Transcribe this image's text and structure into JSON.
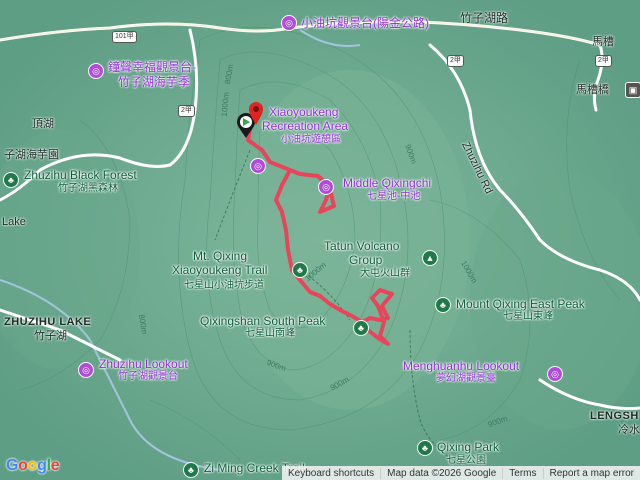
{
  "map": {
    "poi_labels": {
      "xiaoyoukeng_viewpoint_zh": "小油坑觀景台(陽金公路)",
      "bell_viewpoint_zh": "鐘聲幸福觀景台-",
      "bell_viewpoint_zh2": "竹子湖海芋季",
      "xiaoyoukeng_rec_en1": "Xiaoyoukeng",
      "xiaoyoukeng_rec_en2": "Recreation Area",
      "xiaoyoukeng_rec_zh": "小油坑遊憩區",
      "middle_qixingchi_en": "Middle Qixingchi",
      "middle_qixingchi_zh": "七星池-中池",
      "zhuzihu_lookout_en": "Zhuzihu Lookout",
      "zhuzihu_lookout_zh": "竹子湖觀景台",
      "menghuanhu_lookout_en": "Menghuanhu Lookout",
      "menghuanhu_lookout_zh": "夢幻湖觀景臺"
    },
    "park_labels": {
      "black_forest_en": "Zhuzihu Black Forest",
      "black_forest_zh": "竹子湖黑森林",
      "trail_en1": "Mt. Qixing",
      "trail_en2": "Xiaoyoukeng Trail",
      "trail_zh": "七星山小油坑步道",
      "south_peak_en": "Qixingshan South Peak",
      "south_peak_zh": "七星山南峰",
      "tatun_en1": "Tatun Volcano",
      "tatun_en2": "Group",
      "tatun_zh": "大屯火山群",
      "east_peak_en": "Mount Qixing East Peak",
      "east_peak_zh": "七星山東峰",
      "qixing_park_en": "Qixing Park",
      "qixing_park_zh": "七星公園",
      "ziming_en": "Zi Ming Creek Trail"
    },
    "place_labels": {
      "dinghu": "頂湖",
      "zhuzihu_taro": "子湖海芋園",
      "lake": "Lake",
      "zhuzihu_lake_en": "ZHUZIHU LAKE",
      "zhuzihu_lake_zh": "竹子湖",
      "macao_bridge": "馬槽橋",
      "macao": "馬槽",
      "lengshuikeng_en": "LENGSH",
      "lengshuikeng_zh": "冷水"
    },
    "road_labels": {
      "zhuzihu_road": "竹子湖路",
      "zhuzihu_rd_en": "Zhuzihu Rd"
    },
    "shields": [
      "101甲",
      "2甲",
      "2甲",
      "2甲"
    ],
    "contours": [
      "800m",
      "900m",
      "1000m",
      "1000m",
      "900m",
      "1000m",
      "900m",
      "800m",
      "900m"
    ],
    "colors": {
      "track": "#e8455b",
      "poi": "#b04bdc",
      "park": "#1f7a4a",
      "road": "#ffffff",
      "terrain": "#5e9e84"
    },
    "logo": "Google",
    "attribution": {
      "shortcuts": "Keyboard shortcuts",
      "data": "Map data ©2026 Google",
      "terms": "Terms",
      "report": "Report a map error"
    }
  }
}
